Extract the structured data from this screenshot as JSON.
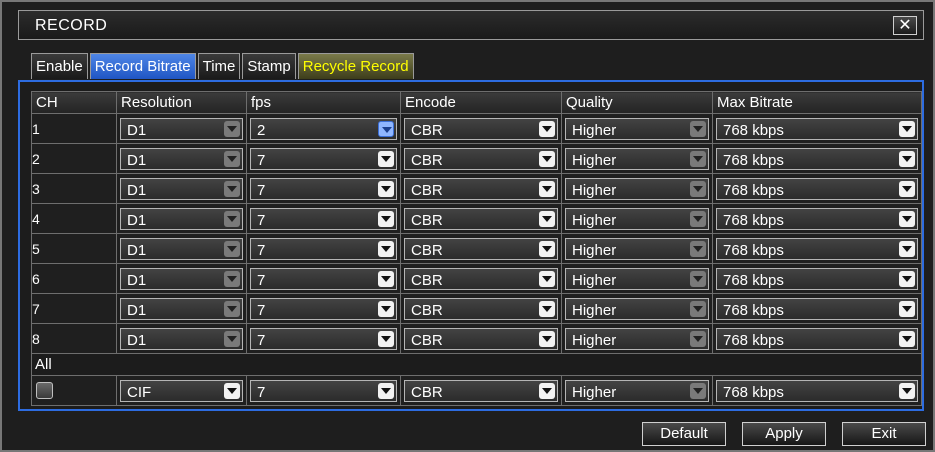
{
  "window": {
    "title": "RECORD",
    "close_symbol": "✕"
  },
  "tabs": [
    {
      "label": "Enable"
    },
    {
      "label": "Record Bitrate"
    },
    {
      "label": "Time"
    },
    {
      "label": "Stamp"
    },
    {
      "label": "Recycle Record"
    }
  ],
  "table": {
    "headers": [
      "CH",
      "Resolution",
      "fps",
      "Encode",
      "Quality",
      "Max Bitrate"
    ],
    "rows": [
      {
        "ch": "1",
        "resolution": "D1",
        "fps": "2",
        "encode": "CBR",
        "quality": "Higher",
        "max_bitrate": "768 kbps"
      },
      {
        "ch": "2",
        "resolution": "D1",
        "fps": "7",
        "encode": "CBR",
        "quality": "Higher",
        "max_bitrate": "768 kbps"
      },
      {
        "ch": "3",
        "resolution": "D1",
        "fps": "7",
        "encode": "CBR",
        "quality": "Higher",
        "max_bitrate": "768 kbps"
      },
      {
        "ch": "4",
        "resolution": "D1",
        "fps": "7",
        "encode": "CBR",
        "quality": "Higher",
        "max_bitrate": "768 kbps"
      },
      {
        "ch": "5",
        "resolution": "D1",
        "fps": "7",
        "encode": "CBR",
        "quality": "Higher",
        "max_bitrate": "768 kbps"
      },
      {
        "ch": "6",
        "resolution": "D1",
        "fps": "7",
        "encode": "CBR",
        "quality": "Higher",
        "max_bitrate": "768 kbps"
      },
      {
        "ch": "7",
        "resolution": "D1",
        "fps": "7",
        "encode": "CBR",
        "quality": "Higher",
        "max_bitrate": "768 kbps"
      },
      {
        "ch": "8",
        "resolution": "D1",
        "fps": "7",
        "encode": "CBR",
        "quality": "Higher",
        "max_bitrate": "768 kbps"
      }
    ],
    "all": {
      "label": "All",
      "checked": false,
      "resolution": "CIF",
      "fps": "7",
      "encode": "CBR",
      "quality": "Higher",
      "max_bitrate": "768 kbps"
    }
  },
  "buttons": {
    "default": "Default",
    "apply": "Apply",
    "exit": "Exit"
  },
  "colors": {
    "accent": "#2d6ce0",
    "active_tab": "#2f66d6",
    "recycle_tab_text": "#ffff00"
  },
  "icons": {
    "dropdown": "chevron-down-icon",
    "close": "close-icon"
  }
}
